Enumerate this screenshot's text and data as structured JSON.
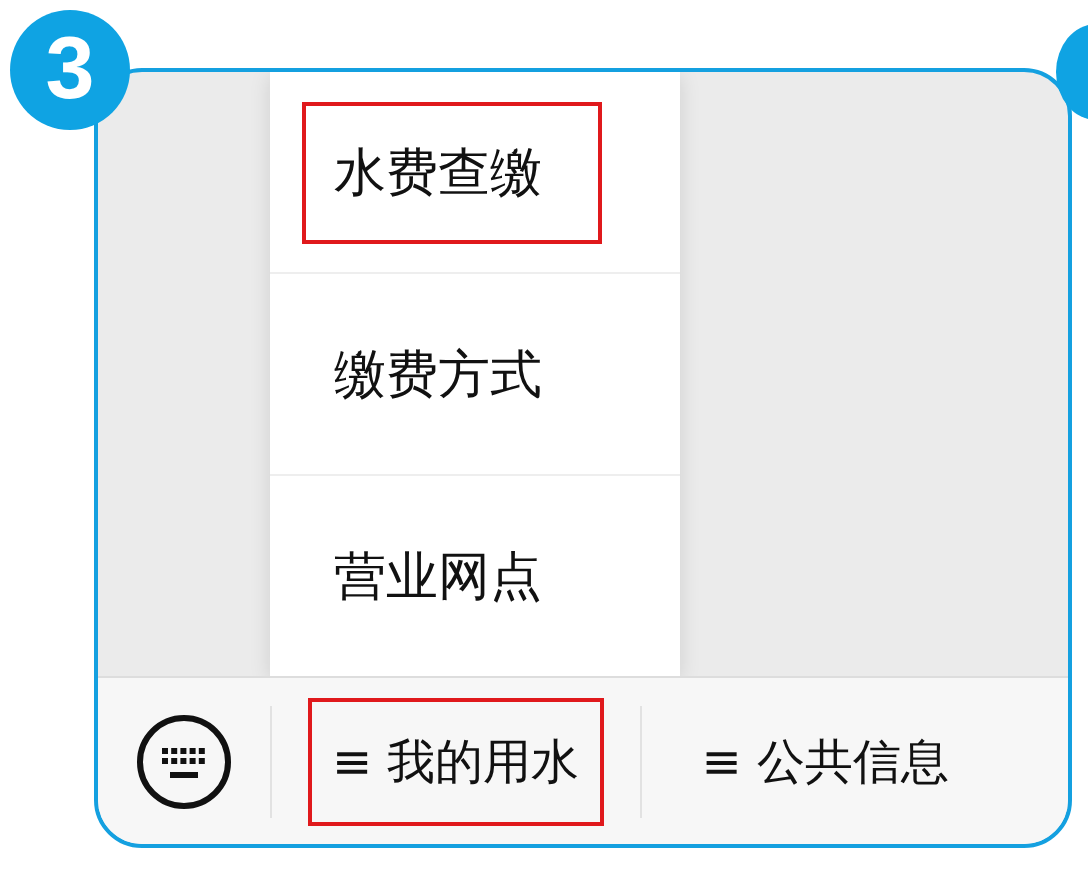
{
  "step_badge": "3",
  "popup_menu": [
    {
      "label": "水费查缴",
      "highlighted": true
    },
    {
      "label": "缴费方式",
      "highlighted": false
    },
    {
      "label": "营业网点",
      "highlighted": false
    }
  ],
  "bottom_menu": [
    {
      "label": "≡ 我的用水",
      "highlighted": true
    },
    {
      "label": "≡ 公共信息",
      "highlighted": false
    }
  ]
}
